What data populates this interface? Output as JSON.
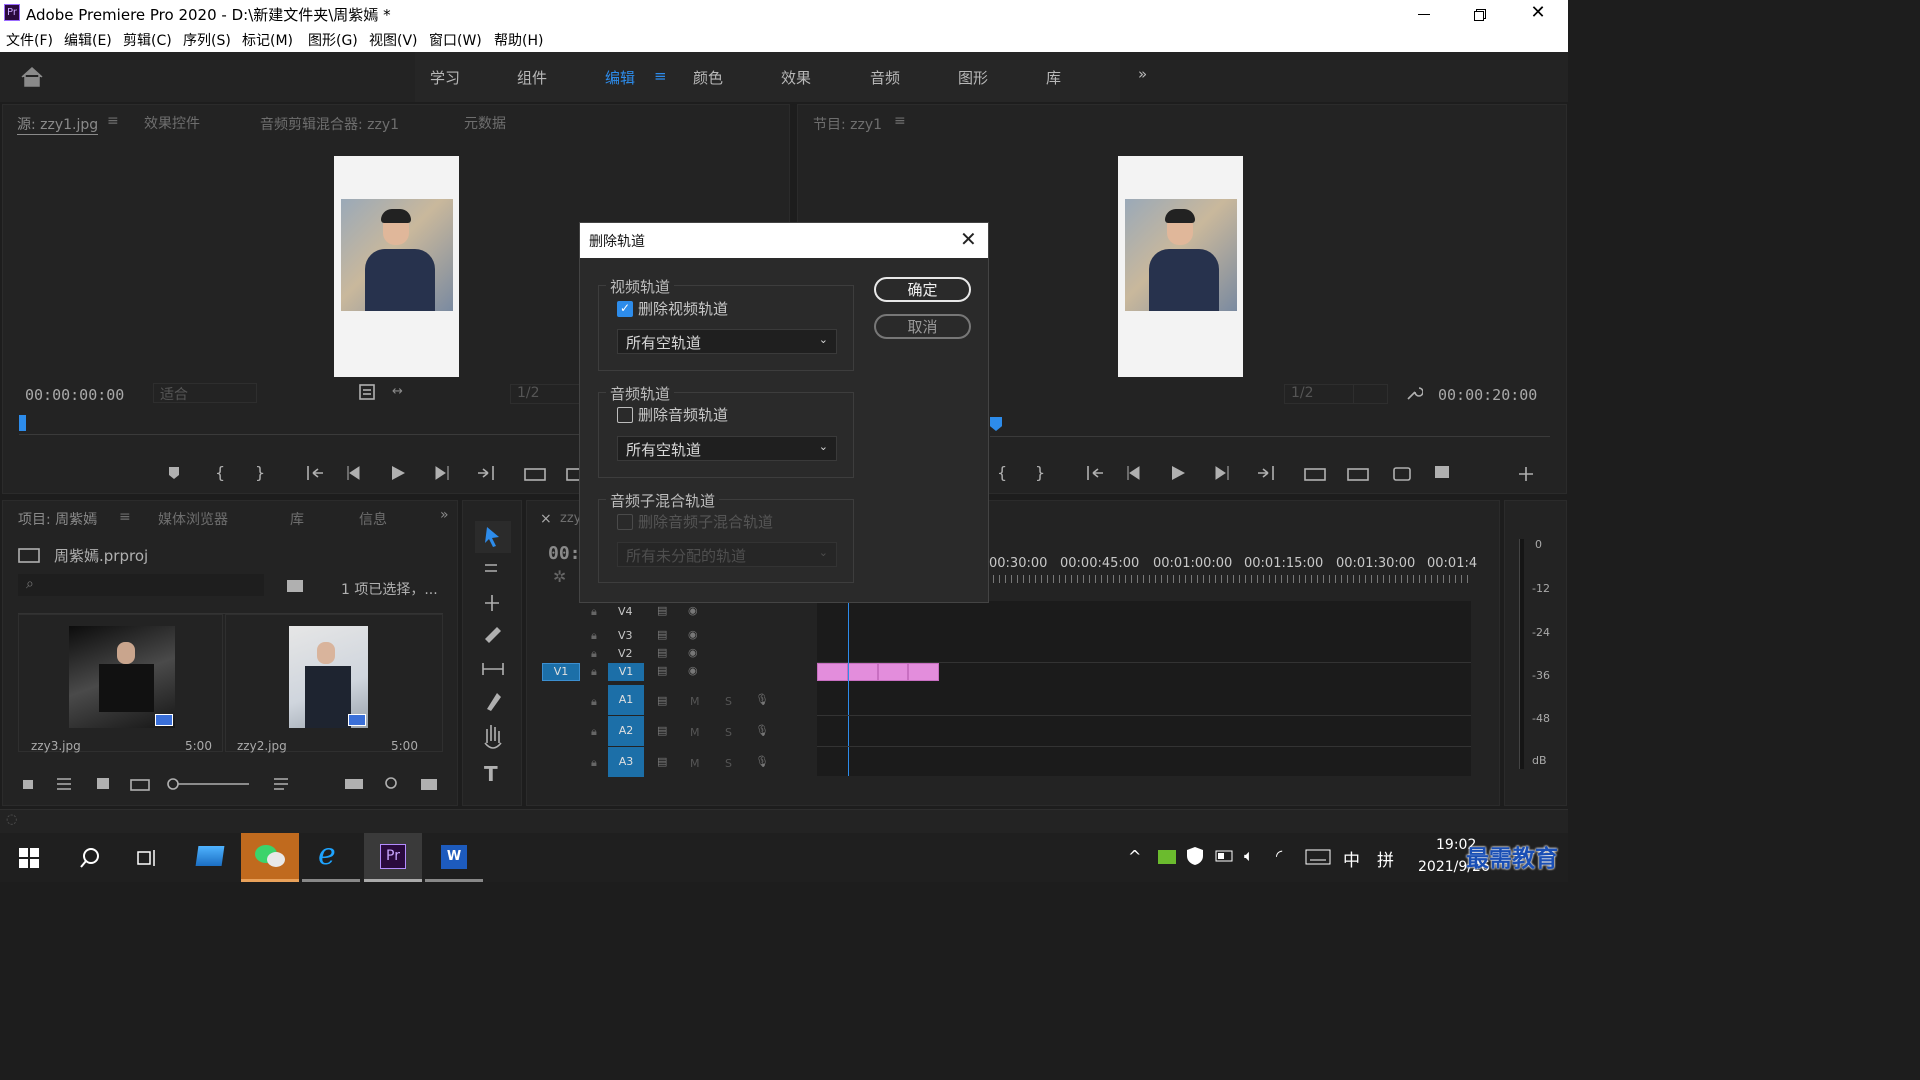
{
  "window": {
    "title": "Adobe Premiere Pro 2020 - D:\\新建文件夹\\周紫嫣 *",
    "app_icon": "Pr"
  },
  "menu": [
    "文件(F)",
    "编辑(E)",
    "剪辑(C)",
    "序列(S)",
    "标记(M)",
    "图形(G)",
    "视图(V)",
    "窗口(W)",
    "帮助(H)"
  ],
  "workspaces": [
    "学习",
    "组件",
    "编辑",
    "颜色",
    "效果",
    "音频",
    "图形",
    "库"
  ],
  "workspace_active": "编辑",
  "source_panel": {
    "tabs": [
      "源: zzy1.jpg",
      "效果控件",
      "音频剪辑混合器: zzy1",
      "元数据"
    ],
    "timecode": "00:00:00:00",
    "fit": "适合",
    "resolution": "1/2"
  },
  "program_panel": {
    "tab": "节目: zzy1",
    "timecode": "00:00:20:00",
    "resolution": "1/2"
  },
  "project_panel": {
    "tabs": [
      "项目: 周紫嫣",
      "媒体浏览器",
      "库",
      "信息"
    ],
    "file": "周紫嫣.prproj",
    "selection": "1 项已选择，...",
    "items": [
      {
        "name": "zzy3.jpg",
        "duration": "5:00"
      },
      {
        "name": "zzy2.jpg",
        "duration": "5:00"
      }
    ]
  },
  "timeline": {
    "tab": "zzy",
    "timecode": "00:0",
    "ruler": [
      "00:30:00",
      "00:00:45:00",
      "00:01:00:00",
      "00:01:15:00",
      "00:01:30:00",
      "00:01:4"
    ],
    "video_tracks": [
      "V4",
      "V3",
      "V2",
      "V1"
    ],
    "source_patch": "V1",
    "audio_tracks": [
      "A1",
      "A2",
      "A3"
    ],
    "track_btn_m": "M",
    "track_btn_s": "S",
    "meter_scale": [
      "0",
      "-12",
      "-24",
      "-36",
      "-48",
      "dB"
    ]
  },
  "dialog": {
    "title": "删除轨道",
    "video_group": "视频轨道",
    "video_check": "删除视频轨道",
    "video_checked": true,
    "video_select": "所有空轨道",
    "audio_group": "音频轨道",
    "audio_check": "删除音频轨道",
    "audio_checked": false,
    "audio_select": "所有空轨道",
    "submix_group": "音频子混合轨道",
    "submix_check": "删除音频子混合轨道",
    "submix_select": "所有未分配的轨道",
    "ok": "确定",
    "cancel": "取消"
  },
  "taskbar": {
    "time": "19:02",
    "date": "2021/9/26",
    "ime": "中",
    "ime2": "拼",
    "watermark": "最需教育"
  },
  "colors": {
    "accent": "#2d8ceb",
    "clip": "#e38ddc",
    "track_blue": "#1c6fa8"
  }
}
